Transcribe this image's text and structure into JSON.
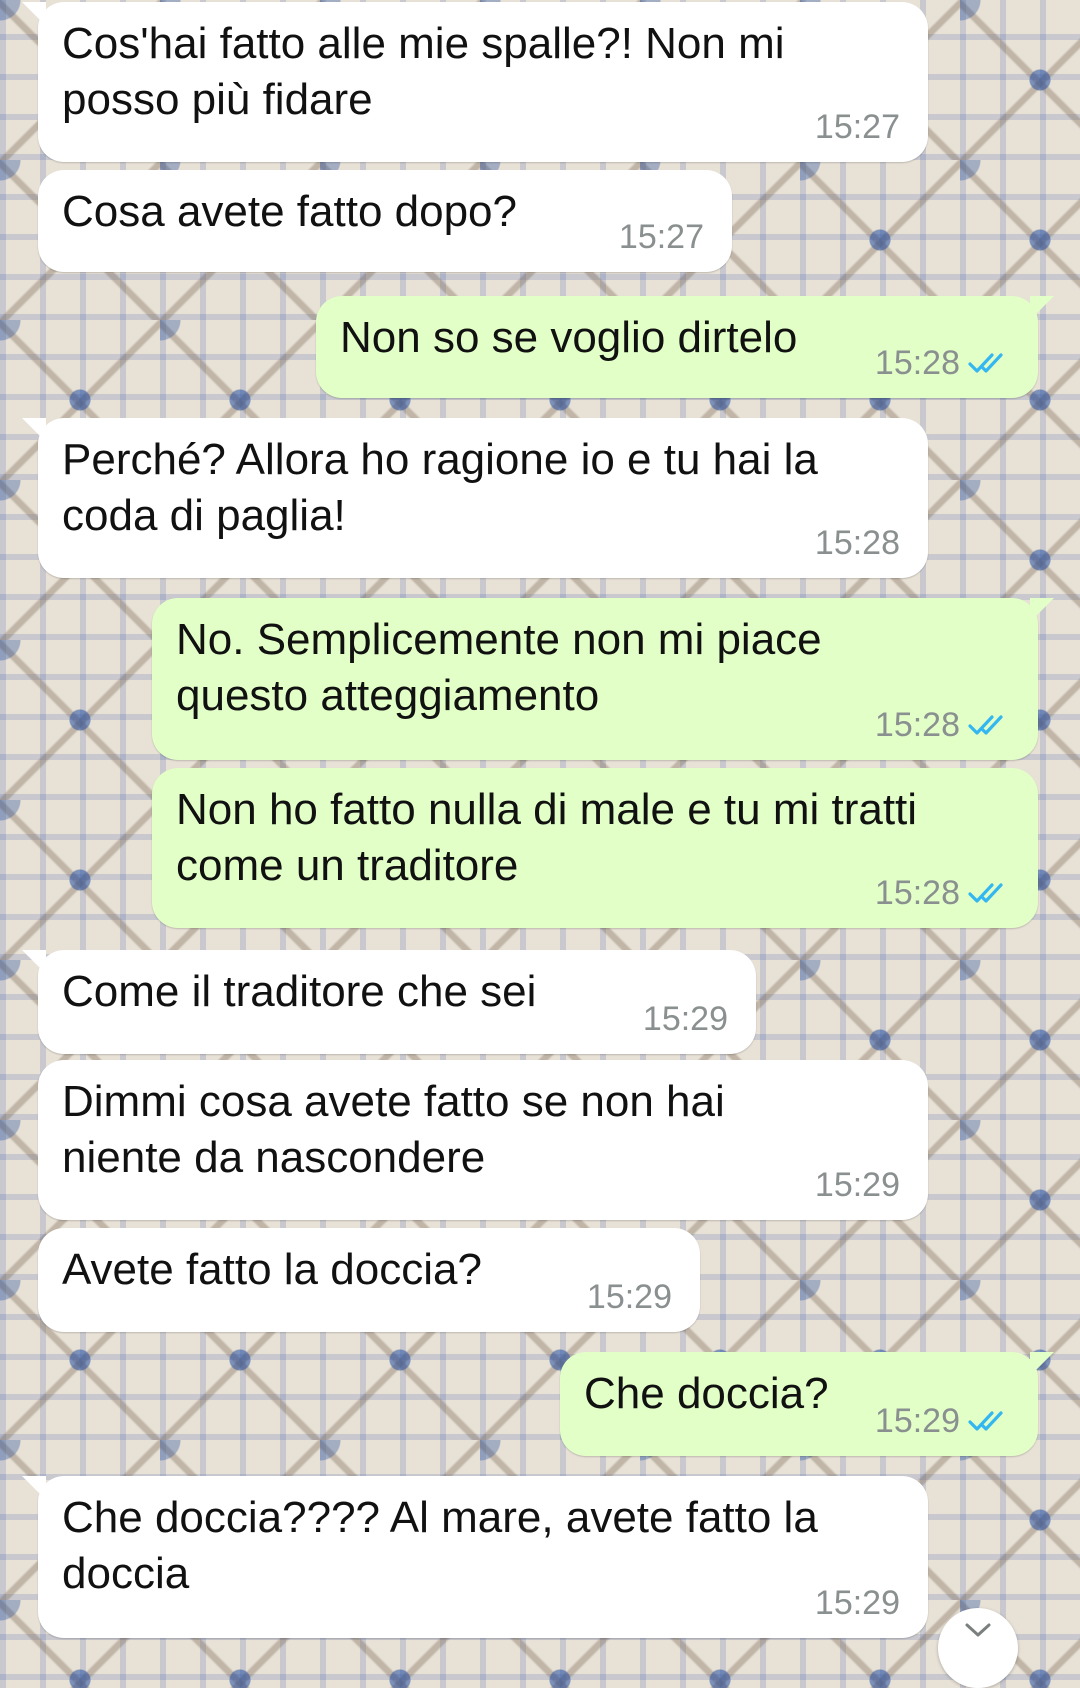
{
  "messages": [
    {
      "dir": "in",
      "lines": [
        "Cos'hai fatto alle mie spalle?! Non mi",
        "posso più fidare"
      ],
      "time": "15:27"
    },
    {
      "dir": "in",
      "lines": [
        "Cosa avete fatto dopo?"
      ],
      "time": "15:27"
    },
    {
      "dir": "out",
      "lines": [
        "Non so se voglio dirtelo"
      ],
      "time": "15:28",
      "status": "read"
    },
    {
      "dir": "in",
      "lines": [
        "Perché? Allora ho ragione io e tu hai la",
        "coda di paglia!"
      ],
      "time": "15:28"
    },
    {
      "dir": "out",
      "lines": [
        "No. Semplicemente non mi piace",
        "questo atteggiamento"
      ],
      "time": "15:28",
      "status": "read"
    },
    {
      "dir": "out",
      "lines": [
        "Non ho fatto nulla di male e tu mi tratti",
        "come un traditore"
      ],
      "time": "15:28",
      "status": "read"
    },
    {
      "dir": "in",
      "lines": [
        "Come il traditore che sei"
      ],
      "time": "15:29"
    },
    {
      "dir": "in",
      "lines": [
        "Dimmi cosa avete fatto se non hai",
        "niente da nascondere"
      ],
      "time": "15:29"
    },
    {
      "dir": "in",
      "lines": [
        "Avete fatto la doccia?"
      ],
      "time": "15:29"
    },
    {
      "dir": "out",
      "lines": [
        "Che doccia?"
      ],
      "time": "15:29",
      "status": "read"
    },
    {
      "dir": "in",
      "lines": [
        "Che doccia???? Al mare, avete fatto la",
        "doccia"
      ],
      "time": "15:29"
    }
  ],
  "icons": {
    "read_receipt": "double-check-icon",
    "scroll_down": "chevron-down-icon"
  },
  "colors": {
    "incoming": "#ffffff",
    "outgoing": "#e2ffc7",
    "tick": "#34b7f1",
    "time": "#8a8f90"
  }
}
